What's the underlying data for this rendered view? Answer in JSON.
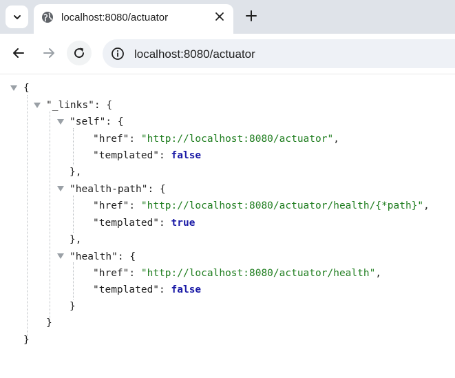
{
  "browser": {
    "tab_title": "localhost:8080/actuator",
    "url": "localhost:8080/actuator"
  },
  "icons": {
    "tab_menu": "chevron-down-icon",
    "tab_favicon": "globe-icon",
    "tab_close": "close-icon",
    "new_tab": "plus-icon",
    "back": "arrow-left-icon",
    "forward": "arrow-right-icon",
    "reload": "reload-icon",
    "site_info": "info-icon",
    "fold": "triangle-down-icon"
  },
  "json": {
    "root_open": "{",
    "root_close": "}",
    "links_key": "\"_links\"",
    "sep": ": ",
    "open_brace": "{",
    "comma": ",",
    "close_brace": "}",
    "close_brace_comma": "},",
    "href_key": "\"href\"",
    "templated_key": "\"templated\"",
    "self": {
      "key": "\"self\"",
      "href": "\"http://localhost:8080/actuator\"",
      "templated": "false"
    },
    "health_path": {
      "key": "\"health-path\"",
      "href": "\"http://localhost:8080/actuator/health/{*path}\"",
      "templated": "true"
    },
    "health": {
      "key": "\"health\"",
      "href": "\"http://localhost:8080/actuator/health\"",
      "templated": "false"
    }
  },
  "colors": {
    "string": "#1e7d1e",
    "boolean": "#1a1aa6",
    "key": "#1f1f1f",
    "tab_strip": "#dfe3e9",
    "omnibox": "#eef1f6"
  }
}
